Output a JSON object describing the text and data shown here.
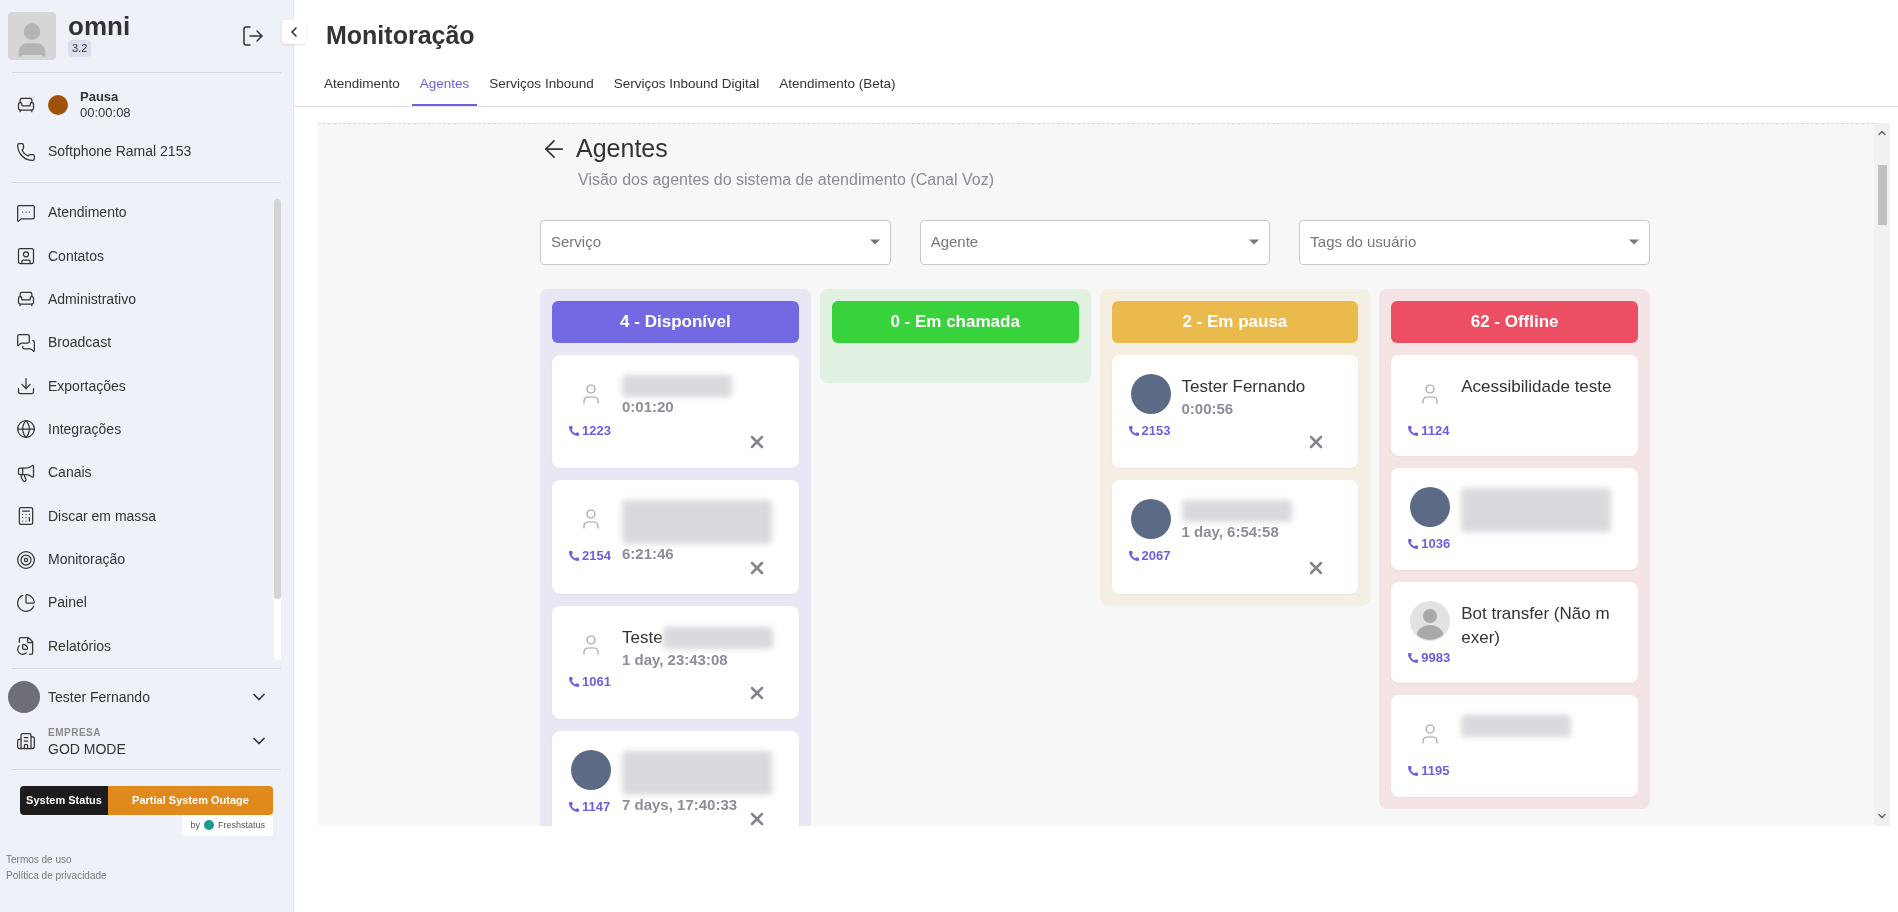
{
  "sidebar": {
    "app_name": "omni",
    "version": "3.2",
    "status": {
      "label": "Pausa",
      "timer": "00:00:08",
      "color": "#a0520a"
    },
    "softphone": "Softphone Ramal 2153",
    "menu": [
      {
        "label": "Atendimento"
      },
      {
        "label": "Contatos"
      },
      {
        "label": "Administrativo"
      },
      {
        "label": "Broadcast"
      },
      {
        "label": "Exportações"
      },
      {
        "label": "Integrações"
      },
      {
        "label": "Canais"
      },
      {
        "label": "Discar em massa"
      },
      {
        "label": "Monitoração"
      },
      {
        "label": "Painel"
      },
      {
        "label": "Relatórios"
      }
    ],
    "user": {
      "name": "Tester Fernando"
    },
    "company": {
      "caption": "EMPRESA",
      "name": "GOD MODE"
    },
    "status_widget": {
      "label": "System Status",
      "state": "Partial System Outage",
      "by": "by",
      "provider": "Freshstatus"
    },
    "footer_links": [
      "Termos de uso",
      "Política de privacidade"
    ]
  },
  "page": {
    "title": "Monitoração",
    "tabs": [
      {
        "label": "Atendimento",
        "selected": false
      },
      {
        "label": "Agentes",
        "selected": true
      },
      {
        "label": "Serviços Inbound",
        "selected": false
      },
      {
        "label": "Serviços Inbound Digital",
        "selected": false
      },
      {
        "label": "Atendimento (Beta)",
        "selected": false
      }
    ]
  },
  "panel": {
    "title": "Agentes",
    "subtitle": "Visão dos agentes do sistema de atendimento (Canal Voz)",
    "filters": [
      {
        "placeholder": "Serviço"
      },
      {
        "placeholder": "Agente"
      },
      {
        "placeholder": "Tags do usuário"
      }
    ],
    "columns": [
      {
        "label": "4 - Disponível",
        "color": "#7269e3",
        "cards": [
          {
            "kind": "outline",
            "name_hidden": true,
            "name_long": false,
            "duration": "0:01:20",
            "extension": "1223",
            "removable": true
          },
          {
            "kind": "outline",
            "name_hidden": true,
            "name_long": true,
            "duration": "6:21:46",
            "extension": "2154",
            "removable": true
          },
          {
            "kind": "outline",
            "name": "Teste",
            "name_hidden": true,
            "name_long": false,
            "duration": "1 day, 23:43:08",
            "extension": "1061",
            "removable": true
          },
          {
            "kind": "photo",
            "name_hidden": true,
            "name_long": true,
            "duration": "7 days, 17:40:33",
            "extension": "1147",
            "removable": true
          }
        ]
      },
      {
        "label": "0 - Em chamada",
        "color": "#38d23c"
      },
      {
        "label": "2 - Em pausa",
        "color": "#ebba4c",
        "cards": [
          {
            "kind": "photo",
            "name": "Tester Fernando",
            "name_hidden": false,
            "duration": "0:00:56",
            "extension": "2153",
            "removable": true
          },
          {
            "kind": "photo",
            "name_hidden": true,
            "name_long": false,
            "duration": "1 day, 6:54:58",
            "extension": "2067",
            "removable": true
          }
        ]
      },
      {
        "label": "62 - Offline",
        "color": "#ec4f63",
        "cards": [
          {
            "kind": "outline",
            "name": "Acessibilidade teste",
            "name_hidden": false,
            "extension": "1124",
            "removable": false
          },
          {
            "kind": "photo",
            "name_hidden": true,
            "name_long": true,
            "extension": "1036",
            "removable": false
          },
          {
            "kind": "silhouette",
            "name": "Bot transfer (Não m exer)",
            "name_hidden": false,
            "extension": "9983",
            "removable": false
          },
          {
            "kind": "outline",
            "name_hidden": true,
            "name_long": false,
            "extension": "1195",
            "removable": false
          }
        ]
      }
    ]
  }
}
